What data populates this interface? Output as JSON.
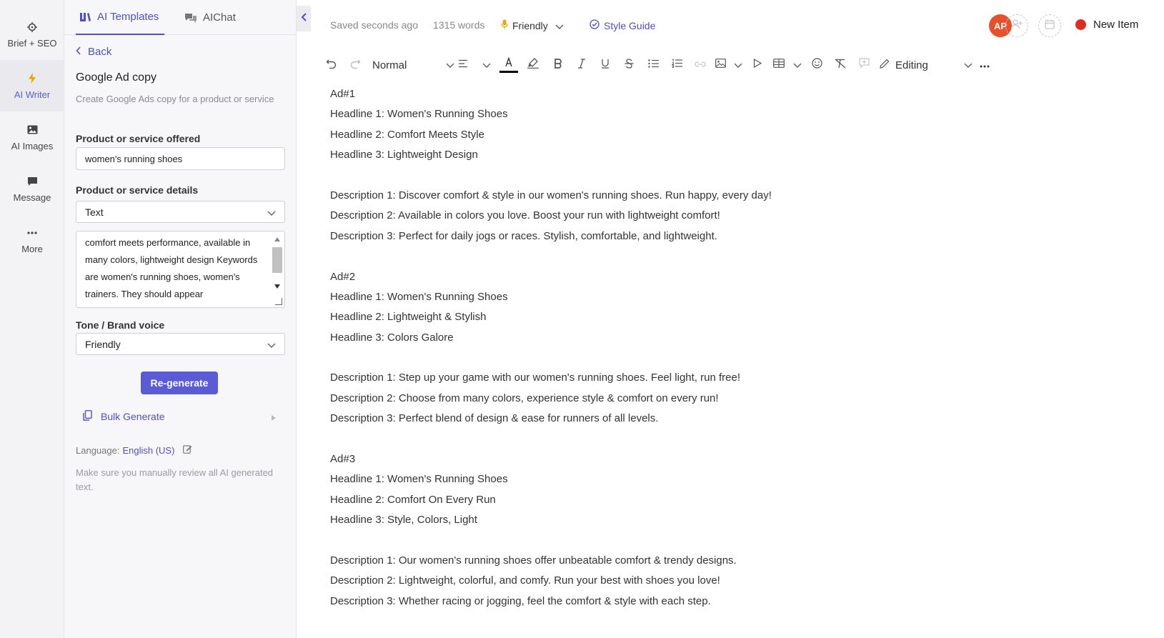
{
  "rail": {
    "items": [
      {
        "label": "Brief + SEO",
        "icon": "crosshair-icon"
      },
      {
        "label": "AI Writer",
        "icon": "lightning-icon"
      },
      {
        "label": "AI Images",
        "icon": "image-icon"
      },
      {
        "label": "Message",
        "icon": "chat-icon"
      },
      {
        "label": "More",
        "icon": "ellipsis-icon"
      }
    ]
  },
  "panel": {
    "tabs": [
      {
        "label": "AI Templates",
        "icon": "templates-icon"
      },
      {
        "label": "AIChat",
        "icon": "chat-bubbles-icon"
      }
    ],
    "back_label": "Back",
    "template_title": "Google Ad copy",
    "template_desc": "Create Google Ads copy for a product or service",
    "product_label": "Product or service offered",
    "product_value": "women's running shoes",
    "details_label": "Product or service details",
    "details_type": "Text",
    "details_text": "comfort meets performance, available in many colors, lightweight design Keywords are women's running shoes, women's trainers. They should appear",
    "tone_label": "Tone / Brand voice",
    "tone_value": "Friendly",
    "regenerate_label": "Re-generate",
    "bulk_label": "Bulk Generate",
    "language_prefix": "Language:",
    "language_value": "English (US)",
    "note": "Make sure you manually review all AI generated text."
  },
  "status": {
    "saved": "Saved seconds ago",
    "words": "1315 words",
    "tone": "Friendly",
    "style_guide": "Style Guide",
    "avatar_initials": "AP",
    "avatar_color": "#e8502b",
    "new_item": "New Item"
  },
  "toolbar": {
    "paragraph_style": "Normal",
    "mode": "Editing",
    "text_color": "#000000"
  },
  "document": {
    "ads": [
      {
        "heading": "Ad#1",
        "headlines": [
          "Headline 1: Women's Running Shoes",
          "Headline 2: Comfort Meets Style",
          "Headline 3: Lightweight Design"
        ],
        "descriptions": [
          "Description 1: Discover comfort & style in our women's running shoes. Run happy, every day!",
          "Description 2: Available in colors you love. Boost your run with lightweight comfort!",
          "Description 3: Perfect for daily jogs or races. Stylish, comfortable, and lightweight."
        ]
      },
      {
        "heading": "Ad#2",
        "headlines": [
          "Headline 1: Women's Running Shoes",
          "Headline 2: Lightweight & Stylish",
          "Headline 3: Colors Galore"
        ],
        "descriptions": [
          "Description 1: Step up your game with our women's running shoes. Feel light, run free!",
          "Description 2: Choose from many colors, experience style & comfort on every run!",
          "Description 3: Perfect blend of design & ease for runners of all levels."
        ]
      },
      {
        "heading": "Ad#3",
        "headlines": [
          "Headline 1: Women's Running Shoes",
          "Headline 2: Comfort On Every Run",
          "Headline 3: Style, Colors, Light"
        ],
        "descriptions": [
          "Description 1: Our women's running shoes offer unbeatable comfort & trendy designs.",
          "Description 2: Lightweight, colorful, and comfy. Run your best with shoes you love!",
          "Description 3: Whether racing or jogging, feel the comfort & style with each step."
        ]
      }
    ]
  }
}
